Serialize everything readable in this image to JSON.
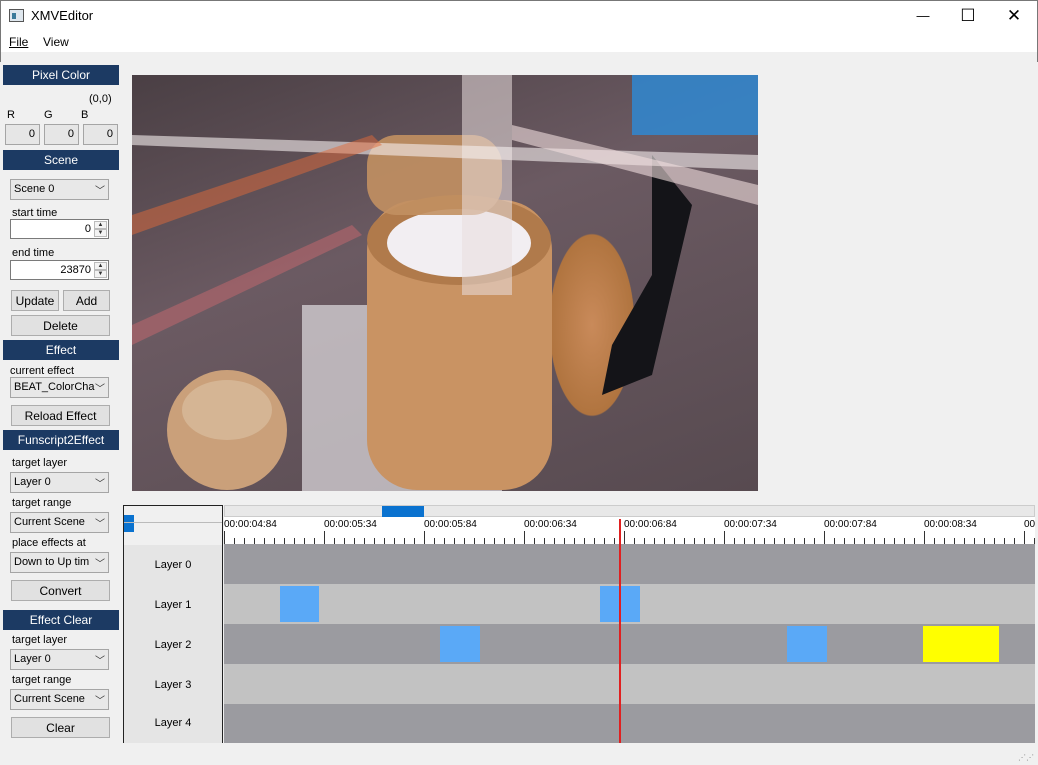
{
  "window": {
    "title": "XMVEditor",
    "minimize_glyph": "—",
    "maximize_glyph": "☐",
    "close_glyph": "✕"
  },
  "menu": {
    "file": "File",
    "view": "View"
  },
  "pixel_color": {
    "header": "Pixel Color",
    "coords": "(0,0)",
    "r_label": "R",
    "g_label": "G",
    "b_label": "B",
    "r": "0",
    "g": "0",
    "b": "0"
  },
  "scene": {
    "header": "Scene",
    "selected": "Scene 0",
    "start_label": "start time",
    "start_value": "0",
    "end_label": "end time",
    "end_value": "23870",
    "update": "Update",
    "add": "Add",
    "delete": "Delete"
  },
  "effect": {
    "header": "Effect",
    "current_label": "current effect",
    "current_value": "BEAT_ColorCha",
    "reload": "Reload Effect"
  },
  "funscript": {
    "header": "Funscript2Effect",
    "target_layer_label": "target layer",
    "target_layer_value": "Layer 0",
    "target_range_label": "target range",
    "target_range_value": "Current Scene",
    "place_label": "place effects at",
    "place_value": "Down to Up tim",
    "convert": "Convert"
  },
  "effect_clear": {
    "header": "Effect Clear",
    "target_layer_label": "target layer",
    "target_layer_value": "Layer 0",
    "target_range_label": "target range",
    "target_range_value": "Current Scene",
    "clear": "Clear"
  },
  "timeline": {
    "ticks": [
      "00:00:04:84",
      "00:00:05:34",
      "00:00:05:84",
      "00:00:06:34",
      "00:00:06:84",
      "00:00:07:34",
      "00:00:07:84",
      "00:00:08:34",
      "00"
    ],
    "layers": [
      "Layer 0",
      "Layer 1",
      "Layer 2",
      "Layer 3",
      "Layer 4"
    ],
    "colors": {
      "effect": "#5aa9f7",
      "selected": "#ffff00",
      "playhead": "#e02020",
      "dark_track": "#9b9ba0",
      "light_track": "#c2c2c2"
    }
  },
  "icons": {
    "dropdown": "chevron-down-icon",
    "spin_up": "chevron-up-icon",
    "spin_down": "chevron-down-icon",
    "resize": "resize-grip-icon"
  }
}
